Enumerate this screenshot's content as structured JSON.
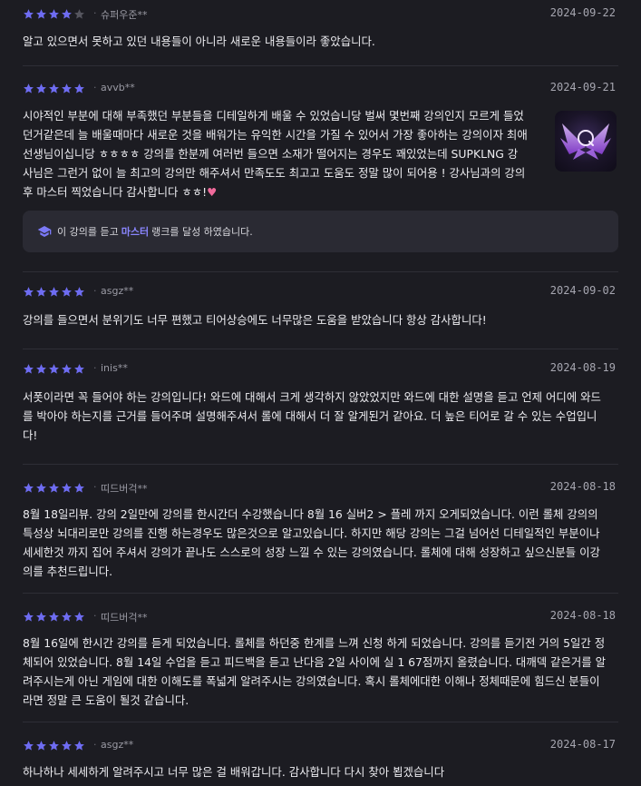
{
  "colors": {
    "star_on": "#6e6cf2",
    "star_off": "#55555e",
    "accent": "#8a86ff",
    "background": "#1c1c22"
  },
  "reviews": [
    {
      "rating": 4,
      "user": "슈퍼우준**",
      "date": "2024-09-22",
      "text": "알고 있으면서 못하고 있던 내용들이 아니라 새로운 내용들이라 좋았습니다."
    },
    {
      "rating": 5,
      "user": "avvb**",
      "date": "2024-09-21",
      "text": "시야적인 부분에 대해 부족했던 부분들을 디테일하게 배울 수 있었습니당 벌써 몇번째 강의인지 모르게 들었던거같은데 늘 배울때마다 새로운 것을 배워가는 유익한 시간을 가질 수 있어서 가장 좋아하는 강의이자 최애선생님이십니당 ㅎㅎㅎㅎ 강의를 한분께 여러번 들으면 소재가 떨어지는 경우도 꽤있었는데 SUPKLNG 강사님은 그런거 없이 늘 최고의 강의만 해주셔서 만족도도 최고고 도움도 정말 많이 되어용 ! 강사님과의 강의 후 마스터 찍었습니다 감사합니다 ㅎㅎ!",
      "heart": "♥",
      "thumbnail": "master-rank-emblem",
      "badge": {
        "prefix": "이 강의를 듣고",
        "rank": "마스터",
        "suffix": "랭크를 달성 하였습니다."
      }
    },
    {
      "rating": 5,
      "user": "asgz**",
      "date": "2024-09-02",
      "text": "강의를 들으면서 분위기도 너무 편했고 티어상승에도 너무많은 도움을 받았습니다 항상 감사합니다!"
    },
    {
      "rating": 5,
      "user": "inis**",
      "date": "2024-08-19",
      "text": "서폿이라면 꼭 들어야 하는 강의입니다! 와드에 대해서 크게 생각하지 않았었지만 와드에 대한 설명을 듣고 언제 어디에 와드를 박아야 하는지를 근거를 들어주며 설명해주셔서 롤에 대해서 더 잘 알게된거 같아요. 더 높은 티어로 갈 수 있는 수업입니다!"
    },
    {
      "rating": 5,
      "user": "띠드버걱**",
      "date": "2024-08-18",
      "text": "8월 18일리뷰. 강의 2일만에 강의를 한시간더 수강했습니다 8월 16 실버2 > 플레 까지 오게되었습니다. 이런 롤체 강의의 특성상 뇌대리로만 강의를 진행 하는경우도 많은것으로 알고있습니다. 하지만 해당 강의는 그걸 넘어선 디테일적인 부분이나 세세한것 까지 집어 주셔서 강의가 끝나도 스스로의 성장 느낄 수 있는 강의였습니다. 롤체에 대해 성장하고 싶으신분들 이강의를 추천드립니다."
    },
    {
      "rating": 5,
      "user": "띠드버걱**",
      "date": "2024-08-18",
      "text": "8월 16일에 한시간 강의를 듣게 되었습니다. 롤체를 하던중 한계를 느껴 신청 하게 되었습니다. 강의를 듣기전 거의 5일간 정체되어 있었습니다. 8월 14일 수업을 듣고 피드백을 듣고 난다음 2일 사이에 실 1 67점까지 올렸습니다. 대깨덱 같은거를 알려주시는게 아닌 게임에 대한 이해도를 폭넓게 알려주시는 강의였습니다. 혹시 롤체에대한 이해나 정체때문에 힘드신 분들이라면 정말 큰 도움이 될것 같습니다."
    },
    {
      "rating": 5,
      "user": "asgz**",
      "date": "2024-08-17",
      "text": "하나하나 세세하게 알려주시고 너무 많은 걸 배워갑니다. 감사합니다 다시 찾아 뵙겠습니다"
    }
  ]
}
